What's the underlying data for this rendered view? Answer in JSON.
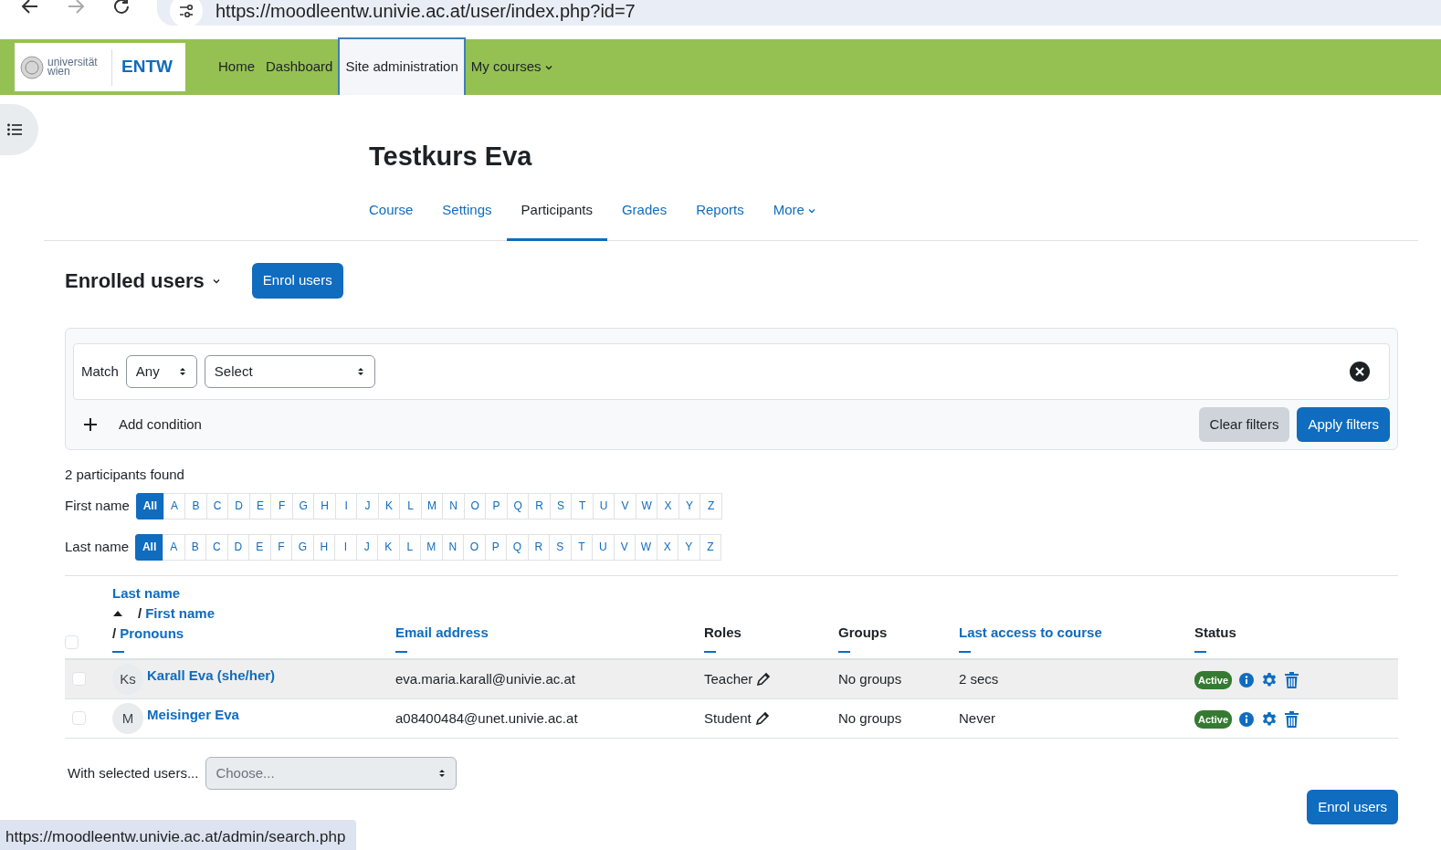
{
  "browser": {
    "url": "https://moodleentw.univie.ac.at/user/index.php?id=7",
    "status_url": "https://moodleentw.univie.ac.at/admin/search.php"
  },
  "navbar": {
    "logo_text": "universität wien",
    "brand": "ENTW",
    "items": [
      {
        "label": "Home",
        "selected": false,
        "dropdown": false
      },
      {
        "label": "Dashboard",
        "selected": false,
        "dropdown": false
      },
      {
        "label": "Site administration",
        "selected": true,
        "dropdown": false
      },
      {
        "label": "My courses",
        "selected": false,
        "dropdown": true
      }
    ]
  },
  "course": {
    "title": "Testkurs Eva",
    "tabs": [
      {
        "label": "Course",
        "selected": false,
        "dropdown": false
      },
      {
        "label": "Settings",
        "selected": false,
        "dropdown": false
      },
      {
        "label": "Participants",
        "selected": true,
        "dropdown": false
      },
      {
        "label": "Grades",
        "selected": false,
        "dropdown": false
      },
      {
        "label": "Reports",
        "selected": false,
        "dropdown": false
      },
      {
        "label": "More",
        "selected": false,
        "dropdown": true
      }
    ]
  },
  "heading": "Enrolled users",
  "enrol_button": "Enrol users",
  "filter": {
    "match_label": "Match",
    "match_value": "Any",
    "condition_value": "Select",
    "add_condition": "Add condition",
    "clear_button": "Clear filters",
    "apply_button": "Apply filters"
  },
  "count": "2 participants found",
  "initials_bars": [
    {
      "label": "First name",
      "letters": [
        {
          "label": "All",
          "selected": true
        },
        {
          "label": "A",
          "selected": false
        },
        {
          "label": "B",
          "selected": false
        },
        {
          "label": "C",
          "selected": false
        },
        {
          "label": "D",
          "selected": false
        },
        {
          "label": "E",
          "selected": false
        },
        {
          "label": "F",
          "selected": false
        },
        {
          "label": "G",
          "selected": false
        },
        {
          "label": "H",
          "selected": false
        },
        {
          "label": "I",
          "selected": false
        },
        {
          "label": "J",
          "selected": false
        },
        {
          "label": "K",
          "selected": false
        },
        {
          "label": "L",
          "selected": false
        },
        {
          "label": "M",
          "selected": false
        },
        {
          "label": "N",
          "selected": false
        },
        {
          "label": "O",
          "selected": false
        },
        {
          "label": "P",
          "selected": false
        },
        {
          "label": "Q",
          "selected": false
        },
        {
          "label": "R",
          "selected": false
        },
        {
          "label": "S",
          "selected": false
        },
        {
          "label": "T",
          "selected": false
        },
        {
          "label": "U",
          "selected": false
        },
        {
          "label": "V",
          "selected": false
        },
        {
          "label": "W",
          "selected": false
        },
        {
          "label": "X",
          "selected": false
        },
        {
          "label": "Y",
          "selected": false
        },
        {
          "label": "Z",
          "selected": false
        }
      ]
    },
    {
      "label": "Last name",
      "letters": [
        {
          "label": "All",
          "selected": true
        },
        {
          "label": "A",
          "selected": false
        },
        {
          "label": "B",
          "selected": false
        },
        {
          "label": "C",
          "selected": false
        },
        {
          "label": "D",
          "selected": false
        },
        {
          "label": "E",
          "selected": false
        },
        {
          "label": "F",
          "selected": false
        },
        {
          "label": "G",
          "selected": false
        },
        {
          "label": "H",
          "selected": false
        },
        {
          "label": "I",
          "selected": false
        },
        {
          "label": "J",
          "selected": false
        },
        {
          "label": "K",
          "selected": false
        },
        {
          "label": "L",
          "selected": false
        },
        {
          "label": "M",
          "selected": false
        },
        {
          "label": "N",
          "selected": false
        },
        {
          "label": "O",
          "selected": false
        },
        {
          "label": "P",
          "selected": false
        },
        {
          "label": "Q",
          "selected": false
        },
        {
          "label": "R",
          "selected": false
        },
        {
          "label": "S",
          "selected": false
        },
        {
          "label": "T",
          "selected": false
        },
        {
          "label": "U",
          "selected": false
        },
        {
          "label": "V",
          "selected": false
        },
        {
          "label": "W",
          "selected": false
        },
        {
          "label": "X",
          "selected": false
        },
        {
          "label": "Y",
          "selected": false
        },
        {
          "label": "Z",
          "selected": false
        }
      ]
    }
  ],
  "table": {
    "select_all_checked": false,
    "columns": [
      {
        "kind": "multi",
        "labels": [
          "Last name",
          "First name",
          "Pronouns"
        ],
        "separators": [
          "/",
          "/"
        ],
        "sorted": true
      },
      {
        "kind": "single",
        "label": "Email address",
        "link": true
      },
      {
        "kind": "single",
        "label": "Roles",
        "link": false
      },
      {
        "kind": "single",
        "label": "Groups",
        "link": false
      },
      {
        "kind": "single",
        "label": "Last access to course",
        "link": true
      },
      {
        "kind": "single",
        "label": "Status",
        "link": false
      }
    ],
    "rows": [
      {
        "checked": false,
        "hovered": true,
        "initials": "Ks",
        "name": "Karall Eva (she/her)",
        "email": "eva.maria.karall@univie.ac.at",
        "role": "Teacher",
        "groups": "No groups",
        "last_access": "2 secs",
        "status": "Active"
      },
      {
        "checked": false,
        "hovered": false,
        "initials": "M",
        "name": "Meisinger Eva",
        "email": "a08400484@unet.univie.ac.at",
        "role": "Student",
        "groups": "No groups",
        "last_access": "Never",
        "status": "Active"
      }
    ]
  },
  "bulk": {
    "label": "With selected users...",
    "value": "Choose..."
  },
  "footer_button": "Enrol users"
}
